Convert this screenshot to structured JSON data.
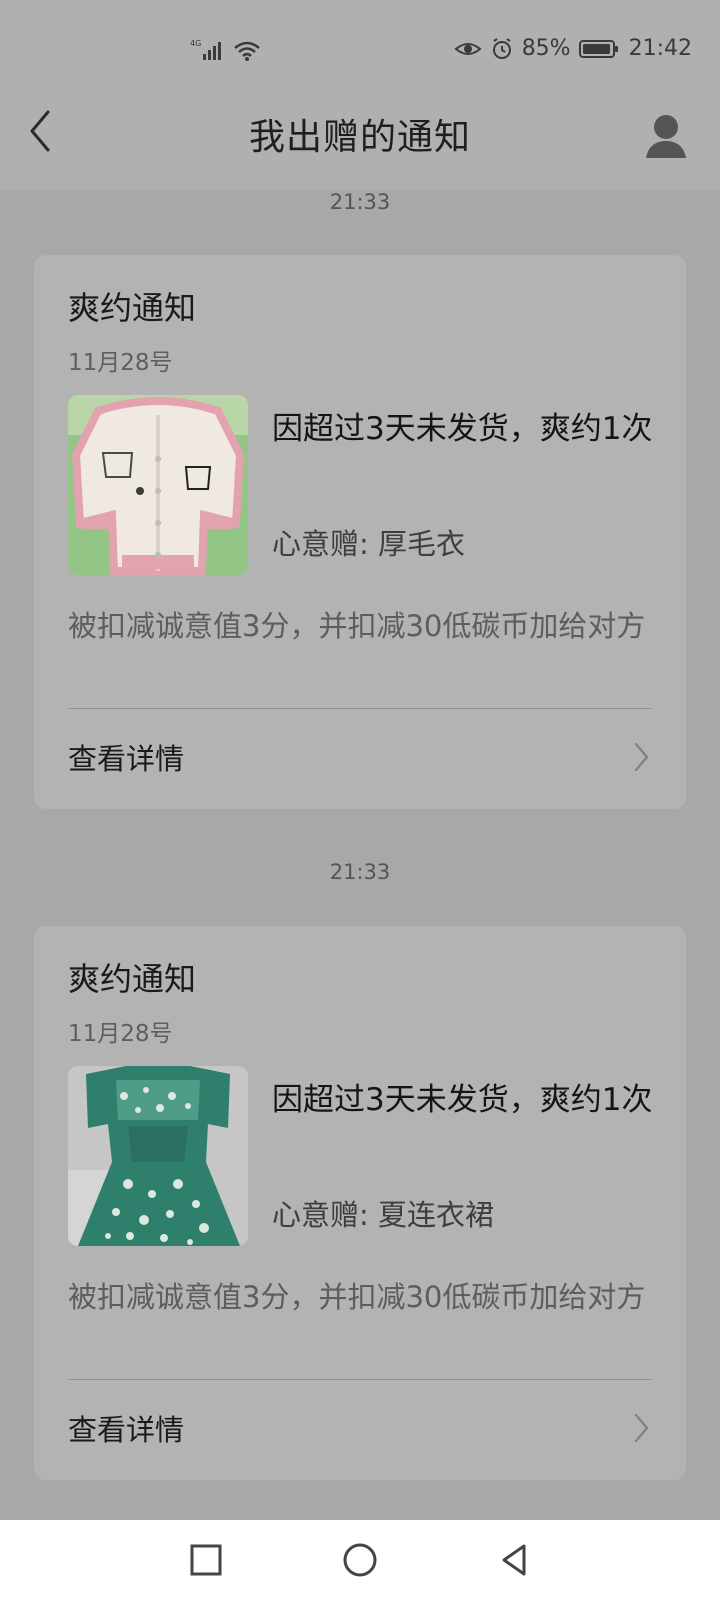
{
  "status_bar": {
    "signal_label": "4G",
    "battery": "85%",
    "time": "21:42",
    "icons": [
      "signal-icon",
      "wifi-icon",
      "eye-icon",
      "alarm-icon",
      "battery-icon"
    ]
  },
  "header": {
    "title": "我出赠的通知",
    "back_icon": "chevron-left-icon",
    "profile_icon": "person-icon"
  },
  "notifications": [
    {
      "time": "21:33",
      "title": "爽约通知",
      "date": "11月28号",
      "message": "因超过3天未发货，爽约1次",
      "gift": "心意赠: 厚毛衣",
      "penalty": "被扣减诚意值3分，并扣减30低碳币加给对方",
      "action": "查看详情"
    },
    {
      "time": "21:33",
      "title": "爽约通知",
      "date": "11月28号",
      "message": "因超过3天未发货，爽约1次",
      "gift": "心意赠: 夏连衣裙",
      "penalty": "被扣减诚意值3分，并扣减30低碳币加给对方",
      "action": "查看详情"
    }
  ],
  "nav": {
    "icons": [
      "square-icon",
      "circle-icon",
      "triangle-back-icon"
    ]
  },
  "colors": {
    "page_bg": "#a8a8a8",
    "header_bg": "#b0b0b0",
    "card_bg": "#b3b3b3",
    "nav_bg": "#ffffff"
  }
}
